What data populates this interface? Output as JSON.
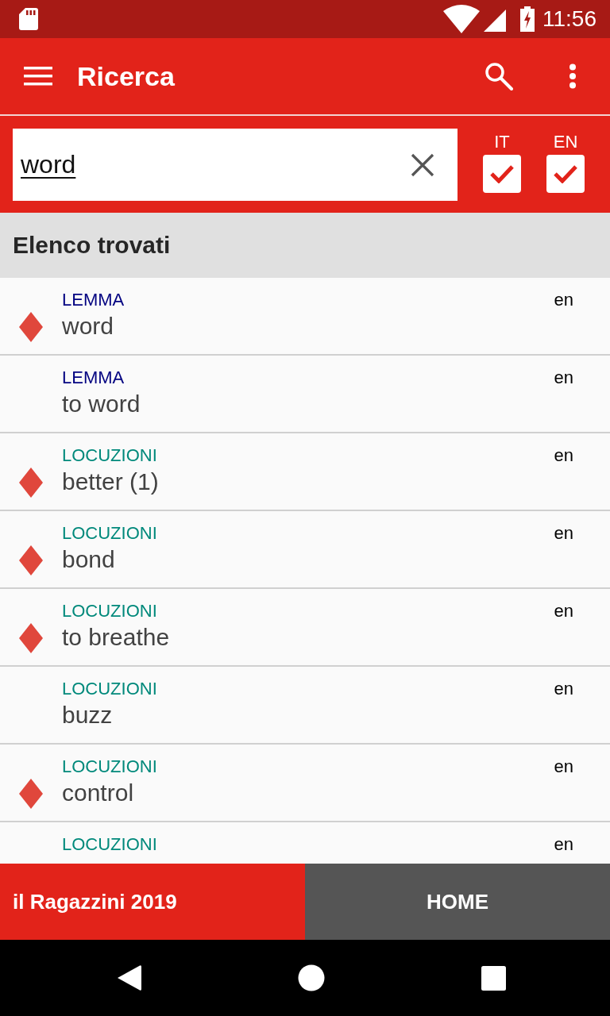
{
  "status_bar": {
    "time": "11:56"
  },
  "app_bar": {
    "title": "Ricerca"
  },
  "search": {
    "value": "word",
    "languages": [
      {
        "label": "IT",
        "checked": true
      },
      {
        "label": "EN",
        "checked": true
      }
    ]
  },
  "results": {
    "title": "Elenco trovati",
    "items": [
      {
        "kind": "lemma",
        "category": "LEMMA",
        "term": "word",
        "lang": "en",
        "marked": true
      },
      {
        "kind": "lemma",
        "category": "LEMMA",
        "term": "to word",
        "lang": "en",
        "marked": false
      },
      {
        "kind": "phrase",
        "category": "LOCUZIONI",
        "term": "better (1)",
        "lang": "en",
        "marked": true
      },
      {
        "kind": "phrase",
        "category": "LOCUZIONI",
        "term": "bond",
        "lang": "en",
        "marked": true
      },
      {
        "kind": "phrase",
        "category": "LOCUZIONI",
        "term": "to breathe",
        "lang": "en",
        "marked": true
      },
      {
        "kind": "phrase",
        "category": "LOCUZIONI",
        "term": "buzz",
        "lang": "en",
        "marked": false
      },
      {
        "kind": "phrase",
        "category": "LOCUZIONI",
        "term": "control",
        "lang": "en",
        "marked": true
      },
      {
        "kind": "phrase",
        "category": "LOCUZIONI",
        "lang": "en"
      }
    ]
  },
  "footer": {
    "brand": "il Ragazzini 2019",
    "home": "HOME"
  }
}
